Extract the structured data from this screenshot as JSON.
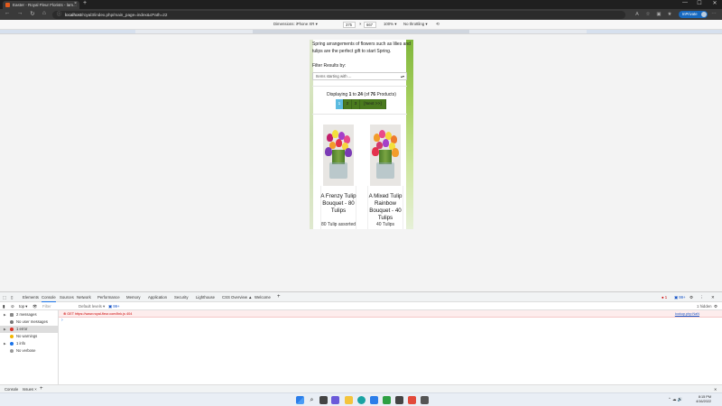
{
  "browser": {
    "tab_title": "Easter - Royal Fleur Florists - lam...",
    "tab_close": "×",
    "new_tab": "+",
    "url_host": "localhost",
    "url_path": "/royal3/index.php/main_page=index&cPath=22",
    "inprivate_label": "InPrivate",
    "window_controls": [
      "—",
      "☐",
      "✕"
    ]
  },
  "device_toolbar": {
    "dimensions_label": "Dimensions: iPhone XR",
    "width": "375",
    "x": "×",
    "height": "667",
    "zoom": "100%",
    "throttle": "No throttling"
  },
  "page": {
    "intro": "Spring arrangements of flowers such as lilies and tulips are the perfect gift to start Spring.",
    "filter_label": "Filter Results by:",
    "filter_select": "Items starting with ...",
    "display_prefix": "Displaying ",
    "display_from": "1",
    "display_to_word": " to ",
    "display_to": "24",
    "display_of_word": " (of ",
    "display_total": "76",
    "display_suffix": " Products)",
    "pages": [
      "1",
      "2",
      "3",
      "[Next >>]"
    ],
    "products": [
      {
        "name": "A Frenzy Tulip Bouquet - 80 Tulips",
        "desc": "80 Tulip assorted arr"
      },
      {
        "name": "A Mixed Tulip Rainbow Bouquet - 40 Tulips",
        "desc": "40 Tulips"
      }
    ]
  },
  "devtools": {
    "tabs": [
      "Elements",
      "Console",
      "Sources",
      "Network",
      "Performance",
      "Memory",
      "Application",
      "Security",
      "Lighthouse",
      "CSS Overview ▲",
      "Welcome"
    ],
    "selected_tab": "Console",
    "context": "top",
    "filter_placeholder": "Filter",
    "levels": "Default levels",
    "issues_badge": "99+",
    "error_count": "1",
    "warning_badge": "99+",
    "hidden_count": "1 hidden",
    "sidebar": [
      {
        "label": "2 messages",
        "kind": "list"
      },
      {
        "label": "No user messages",
        "kind": "user"
      },
      {
        "label": "1 error",
        "kind": "error"
      },
      {
        "label": "No warnings",
        "kind": "warning"
      },
      {
        "label": "1 info",
        "kind": "info"
      },
      {
        "label": "No verbose",
        "kind": "verbose"
      }
    ],
    "error_message": "GET https://www.royal-fleur.com/link.js 404",
    "error_source": "lookup.php:NaN",
    "caret": "›",
    "drawer_tabs": [
      "Console",
      "Issues"
    ]
  },
  "taskbar": {
    "time": "8:15 PM",
    "date": "4/16/2022"
  },
  "colors": {
    "pager_green": "#4a7a1e",
    "pager_active": "#5bbbe0",
    "accent_blue": "#1a73e8",
    "error_red": "#c00000"
  }
}
